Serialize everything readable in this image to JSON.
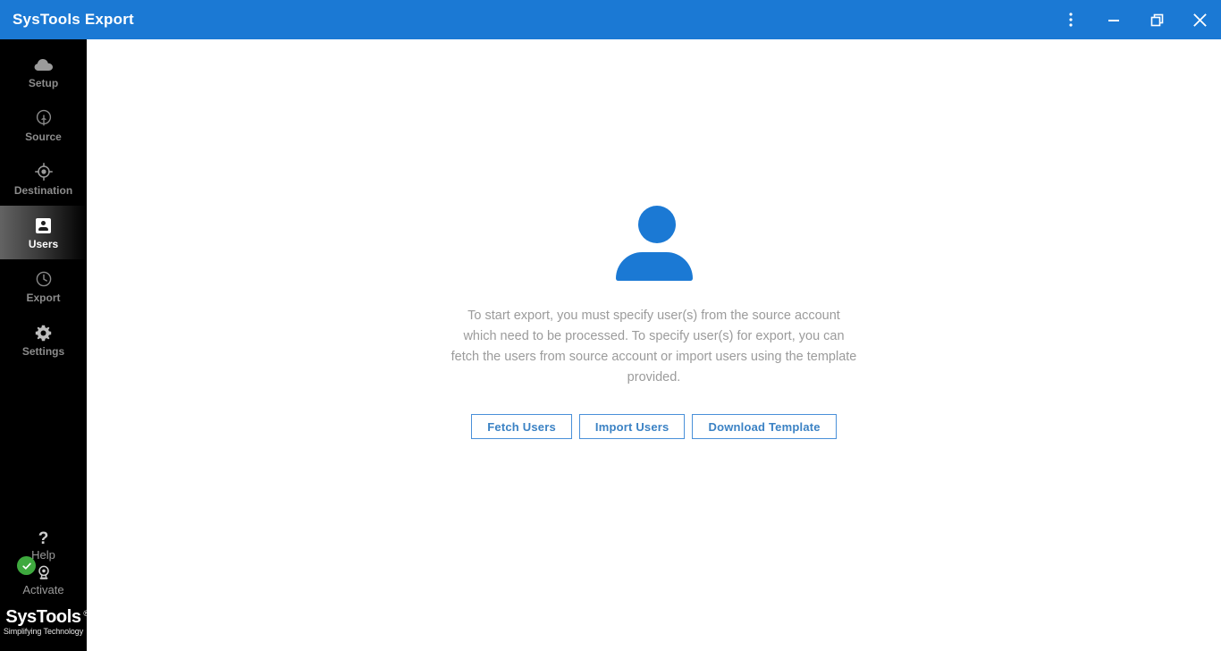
{
  "window": {
    "title": "SysTools Export",
    "titlebar_color": "#1b79d4",
    "controls": [
      {
        "name": "menu",
        "label": "More options",
        "icon": "kebab-menu-icon"
      },
      {
        "name": "minimize",
        "label": "Minimize",
        "icon": "minimize-icon"
      },
      {
        "name": "restore",
        "label": "Restore",
        "icon": "restore-icon"
      },
      {
        "name": "close",
        "label": "Close",
        "icon": "close-icon"
      }
    ]
  },
  "sidebar": {
    "background": "#000000",
    "active_item": "Users",
    "items": [
      {
        "label": "Setup",
        "icon": "cloud-icon",
        "active": false
      },
      {
        "label": "Source",
        "icon": "source-icon",
        "active": false
      },
      {
        "label": "Destination",
        "icon": "target-icon",
        "active": false
      },
      {
        "label": "Users",
        "icon": "user-card-icon",
        "active": true
      },
      {
        "label": "Export",
        "icon": "clock-icon",
        "active": false
      },
      {
        "label": "Settings",
        "icon": "gear-icon",
        "active": false
      }
    ],
    "utilities": [
      {
        "label": "Help",
        "icon": "question-mark-icon"
      },
      {
        "label": "Activate",
        "icon": "award-icon",
        "badge": "check-icon",
        "badge_color": "#3ea93e"
      }
    ],
    "brand": {
      "name": "SysTools",
      "registered": "®",
      "tagline": "Simplifying Technology"
    }
  },
  "main": {
    "illustration": "user-avatar-icon",
    "illustration_color": "#1b79d4",
    "description": "To start export, you must specify user(s) from the source account which need to be processed. To specify user(s) for export, you can fetch the users from source account or import users using the template provided.",
    "buttons": [
      {
        "label": "Fetch Users"
      },
      {
        "label": "Import Users"
      },
      {
        "label": "Download Template"
      }
    ],
    "button_color": "#3b82c4",
    "button_border_color": "#4a90d9"
  }
}
